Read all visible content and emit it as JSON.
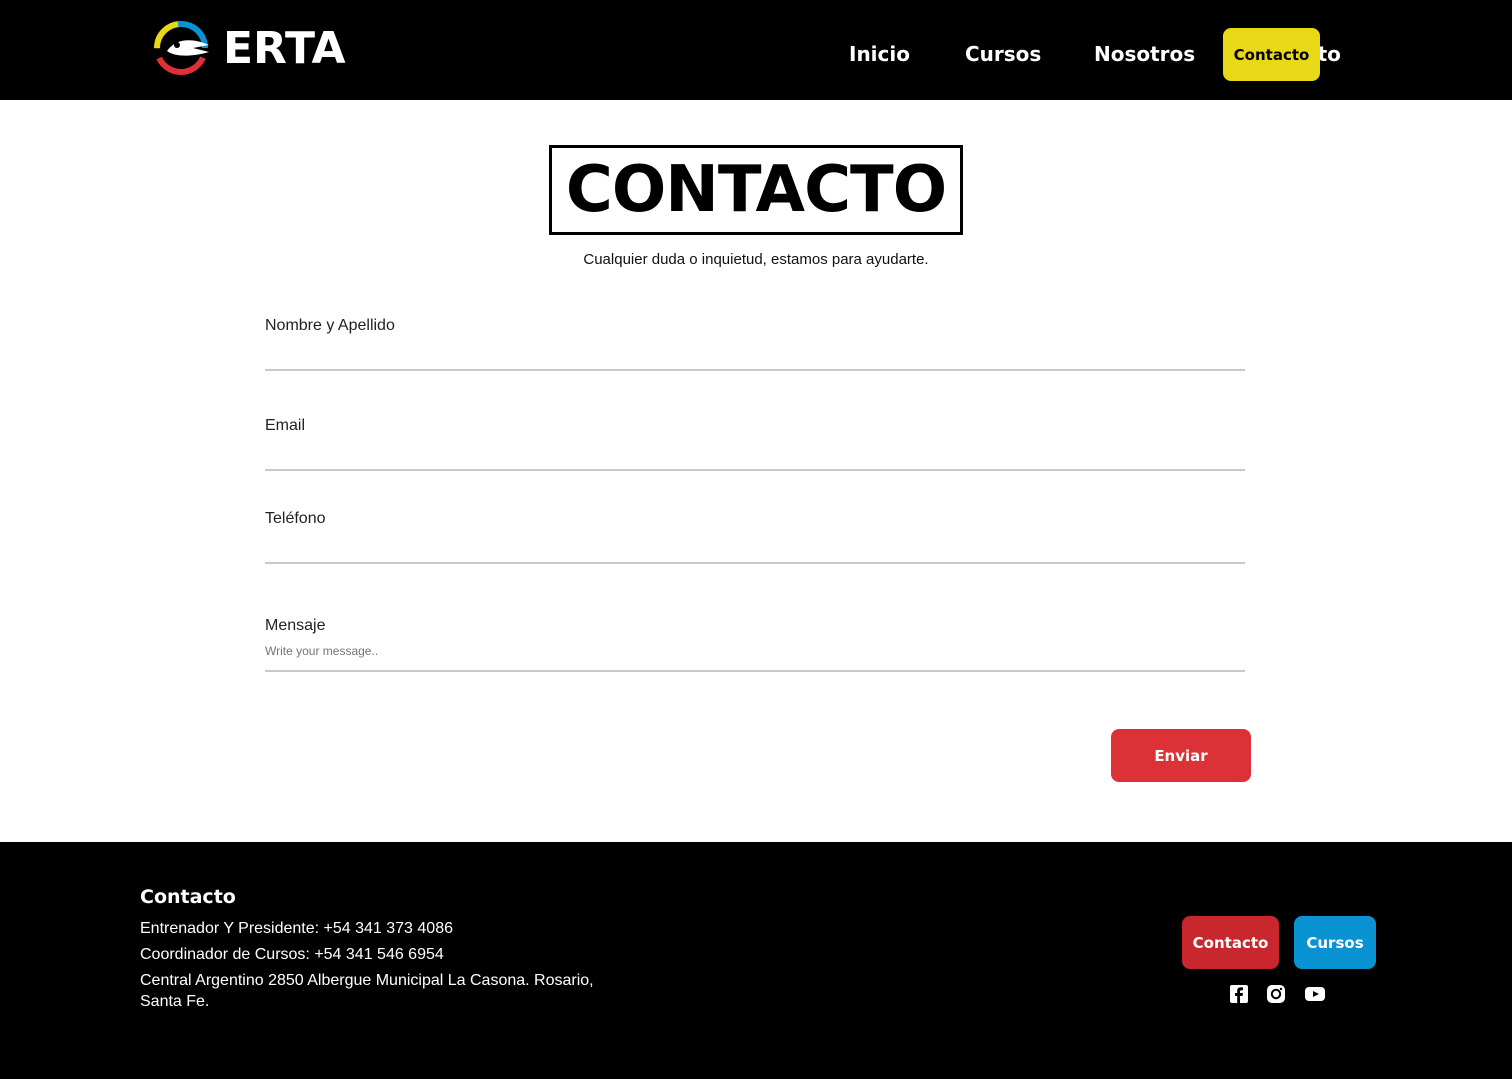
{
  "header": {
    "brand": "ERTA",
    "nav": {
      "inicio": "Inicio",
      "cursos": "Cursos",
      "nosotros": "Nosotros",
      "contacto_hidden": "Contacto",
      "contacto_cta": "Contacto"
    }
  },
  "main": {
    "title": "CONTACTO",
    "subtitle": "Cualquier duda o inquietud, estamos para ayudarte.",
    "form": {
      "name_label": "Nombre y Apellido",
      "email_label": "Email",
      "phone_label": "Teléfono",
      "message_label": "Mensaje",
      "message_placeholder": "Write your message..",
      "submit_label": "Enviar"
    }
  },
  "footer": {
    "title": "Contacto",
    "line1": "Entrenador Y Presidente: +54 341 373 4086",
    "line2": "Coordinador de Cursos: +54 341 546 6954",
    "line3": "Central Argentino 2850 Albergue Municipal La Casona. Rosario, Santa Fe.",
    "contact_button": "Contacto",
    "courses_button": "Cursos",
    "social_icons": [
      "facebook-icon",
      "instagram-icon",
      "youtube-icon"
    ]
  },
  "colors": {
    "header_bg": "#000000",
    "cta_yellow": "#e8d816",
    "send_red": "#dc3237",
    "footer_red": "#c8282d",
    "footer_blue": "#0a93d2"
  }
}
